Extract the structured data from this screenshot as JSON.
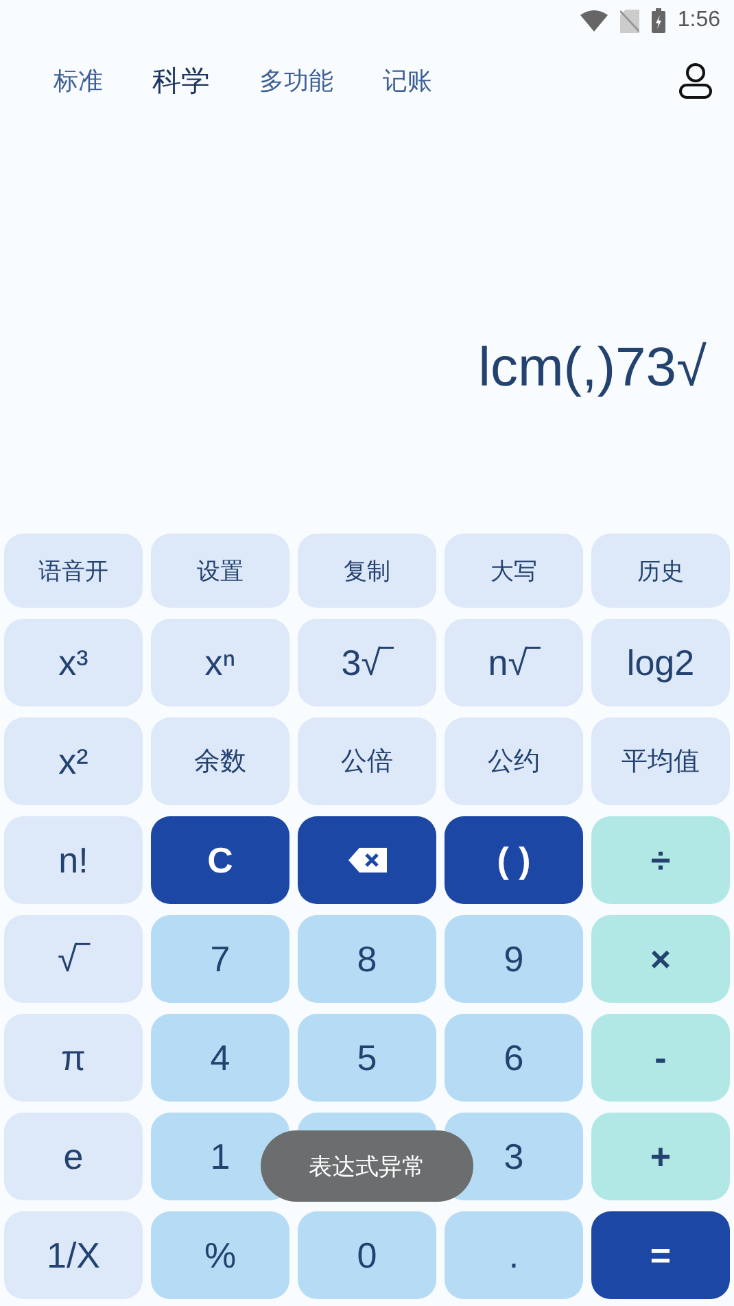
{
  "status_bar": {
    "time": "1:56"
  },
  "tabs": [
    {
      "label": "标准",
      "selected": false
    },
    {
      "label": "科学",
      "selected": true
    },
    {
      "label": "多功能",
      "selected": false
    },
    {
      "label": "记账",
      "selected": false
    }
  ],
  "display": {
    "expression": "lcm(,)73√"
  },
  "keypad": [
    [
      {
        "kind": "tool",
        "label": "语音开"
      },
      {
        "kind": "tool",
        "label": "设置"
      },
      {
        "kind": "tool",
        "label": "复制"
      },
      {
        "kind": "tool",
        "label": "大写"
      },
      {
        "kind": "tool",
        "label": "历史"
      }
    ],
    [
      {
        "kind": "func",
        "label": "x³"
      },
      {
        "kind": "func",
        "label": "xⁿ"
      },
      {
        "kind": "func",
        "label": "3√‾"
      },
      {
        "kind": "func",
        "label": "n√‾"
      },
      {
        "kind": "func",
        "label": "log2"
      }
    ],
    [
      {
        "kind": "func",
        "label": "x²"
      },
      {
        "kind": "func",
        "label": "余数"
      },
      {
        "kind": "func",
        "label": "公倍"
      },
      {
        "kind": "func",
        "label": "公约"
      },
      {
        "kind": "func",
        "label": "平均值"
      }
    ],
    [
      {
        "kind": "func",
        "label": "n!"
      },
      {
        "kind": "action",
        "label": "C"
      },
      {
        "kind": "backspace"
      },
      {
        "kind": "action",
        "label": "( )"
      },
      {
        "kind": "op",
        "label": "÷"
      }
    ],
    [
      {
        "kind": "func",
        "label": "√‾"
      },
      {
        "kind": "digit",
        "label": "7"
      },
      {
        "kind": "digit",
        "label": "8"
      },
      {
        "kind": "digit",
        "label": "9"
      },
      {
        "kind": "op",
        "label": "×"
      }
    ],
    [
      {
        "kind": "func",
        "label": "π"
      },
      {
        "kind": "digit",
        "label": "4"
      },
      {
        "kind": "digit",
        "label": "5"
      },
      {
        "kind": "digit",
        "label": "6"
      },
      {
        "kind": "op",
        "label": "-"
      }
    ],
    [
      {
        "kind": "func",
        "label": "e"
      },
      {
        "kind": "digit",
        "label": "1"
      },
      {
        "kind": "digit"
      },
      {
        "kind": "digit",
        "label": "3"
      },
      {
        "kind": "op",
        "label": "+"
      }
    ],
    [
      {
        "kind": "func",
        "label": "1/X"
      },
      {
        "kind": "digit",
        "label": "%"
      },
      {
        "kind": "digit",
        "label": "0"
      },
      {
        "kind": "digit",
        "label": "."
      },
      {
        "kind": "action",
        "label": "="
      }
    ]
  ],
  "toast": {
    "message": "表达式异常"
  }
}
